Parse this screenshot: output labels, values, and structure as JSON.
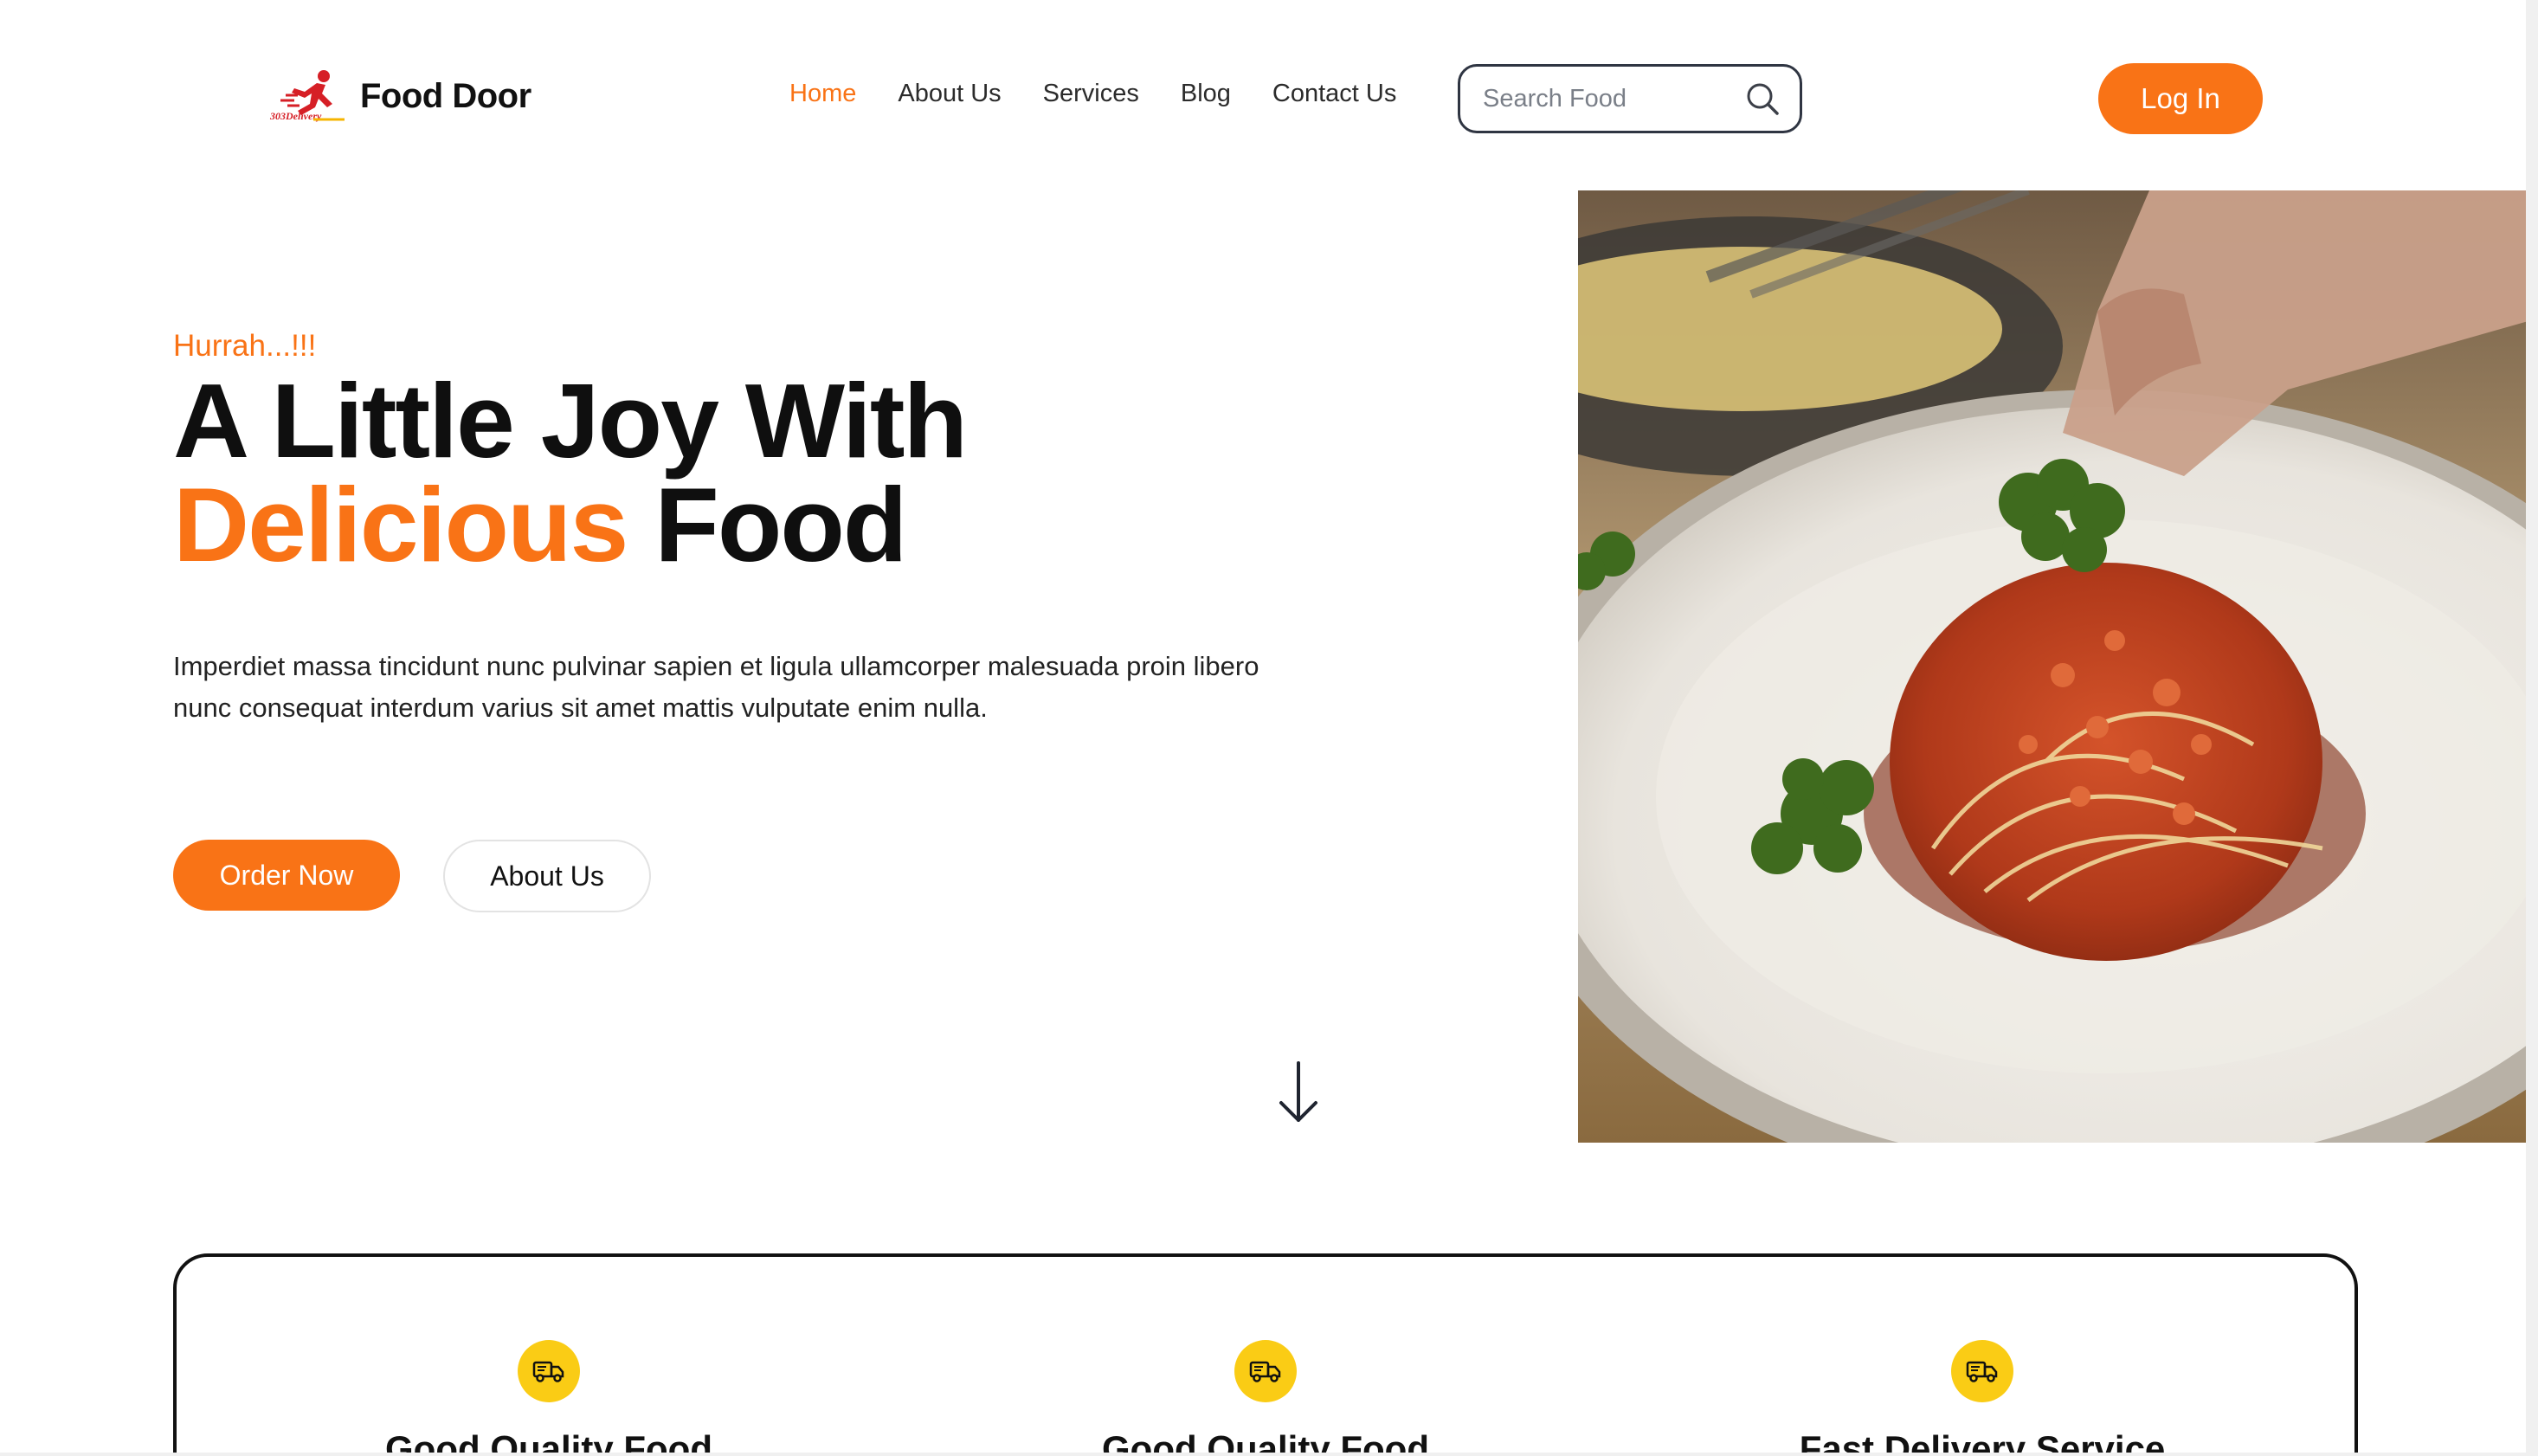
{
  "brand": {
    "name": "Food Door",
    "logo_caption": "303Delivery",
    "logo_icon": "running-courier-logo",
    "accent_color": "#f97316",
    "highlight_color": "#facc15"
  },
  "nav": {
    "items": [
      {
        "label": "Home",
        "active": true
      },
      {
        "label": "About Us",
        "active": false
      },
      {
        "label": "Services",
        "active": false
      },
      {
        "label": "Blog",
        "active": false
      },
      {
        "label": "Contact Us",
        "active": false
      }
    ]
  },
  "search": {
    "placeholder": "Search Food",
    "icon": "search-icon"
  },
  "header": {
    "login_label": "Log In"
  },
  "hero": {
    "eyebrow": "Hurrah...!!!",
    "headline_line1": "A Little Joy With",
    "headline_accent": "Delicious",
    "headline_rest": "Food",
    "description": "Imperdiet massa tincidunt nunc pulvinar sapien et ligula ullamcorper malesuada proin libero nunc consequat interdum varius sit amet mattis vulputate enim nulla.",
    "order_label": "Order Now",
    "about_label": "About Us",
    "scroll_icon": "arrow-down-icon",
    "image_subject": "spaghetti-bolognese-plate"
  },
  "features": [
    {
      "title": "Good Quality Food",
      "icon": "delivery-truck-icon"
    },
    {
      "title": "Good Quality Food",
      "icon": "delivery-truck-icon"
    },
    {
      "title": "Fast Delivery Service",
      "icon": "delivery-truck-icon"
    }
  ]
}
